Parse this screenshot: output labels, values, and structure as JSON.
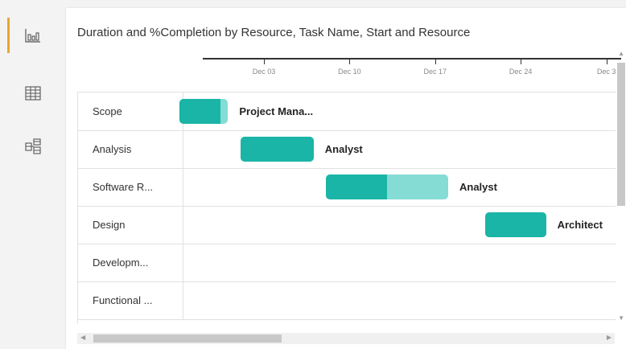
{
  "rail": {
    "items": [
      {
        "icon": "report-view-icon",
        "active": true
      },
      {
        "icon": "data-view-icon",
        "active": false
      },
      {
        "icon": "model-view-icon",
        "active": false
      }
    ],
    "accent": "#e6a830"
  },
  "visual": {
    "title": "Duration and %Completion by Resource, Task Name, Start and Resource"
  },
  "colors": {
    "completed": "#1ab5a6",
    "remaining": "#85dcd4",
    "axis": "#333333",
    "grid": "#e1e1e1"
  },
  "chart_data": {
    "type": "gantt",
    "title": "Duration and %Completion by Resource, Task Name, Start and Resource",
    "x_axis": {
      "type": "date",
      "ticks": [
        "Dec 03",
        "Dec 10",
        "Dec 17",
        "Dec 24",
        "Dec 3"
      ],
      "tick_dates": [
        "2018-12-03",
        "2018-12-10",
        "2018-12-17",
        "2018-12-24",
        "2018-12-31"
      ],
      "range": [
        "2018-11-24",
        "2019-01-01"
      ]
    },
    "tasks": [
      {
        "task": "Scope",
        "resource": "Project Mana...",
        "start": "2018-11-26",
        "end": "2018-11-30",
        "completion": 0.85
      },
      {
        "task": "Analysis",
        "resource": "Analyst",
        "start": "2018-12-01",
        "end": "2018-12-07",
        "completion": 1.0
      },
      {
        "task": "Software R...",
        "resource": "Analyst",
        "start": "2018-12-08",
        "end": "2018-12-18",
        "completion": 0.5
      },
      {
        "task": "Design",
        "resource": "Architect",
        "start": "2018-12-21",
        "end": "2018-12-26",
        "completion": 1.0
      },
      {
        "task": "Developm...",
        "resource": "",
        "start": null,
        "end": null,
        "completion": null
      },
      {
        "task": "Functional ...",
        "resource": "",
        "start": null,
        "end": null,
        "completion": null
      }
    ],
    "grid": true,
    "legend": "none"
  }
}
